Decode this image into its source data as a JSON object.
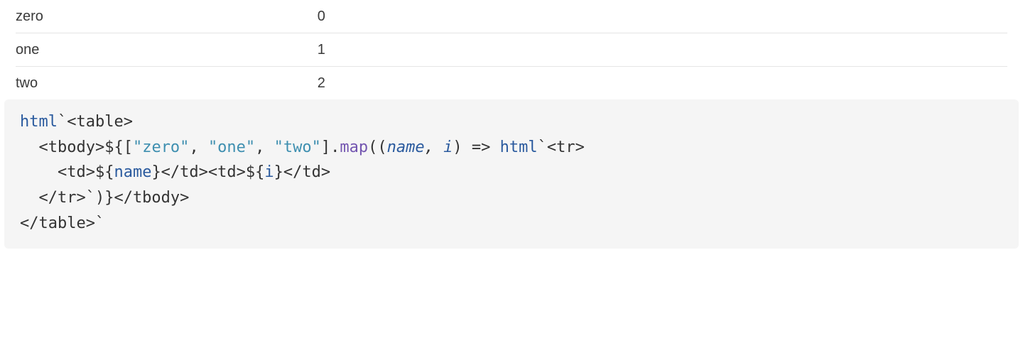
{
  "table": {
    "rows": [
      {
        "name": "zero",
        "index": "0"
      },
      {
        "name": "one",
        "index": "1"
      },
      {
        "name": "two",
        "index": "2"
      }
    ]
  },
  "code": {
    "tokens": [
      {
        "t": "html",
        "c": "tok-fn"
      },
      {
        "t": "`<table>\n  <tbody>${[",
        "c": ""
      },
      {
        "t": "\"zero\"",
        "c": "tok-str"
      },
      {
        "t": ", ",
        "c": ""
      },
      {
        "t": "\"one\"",
        "c": "tok-str"
      },
      {
        "t": ", ",
        "c": ""
      },
      {
        "t": "\"two\"",
        "c": "tok-str"
      },
      {
        "t": "].",
        "c": ""
      },
      {
        "t": "map",
        "c": "tok-method"
      },
      {
        "t": "((",
        "c": ""
      },
      {
        "t": "name",
        "c": "tok-id tok-italic"
      },
      {
        "t": ", ",
        "c": "tok-italic"
      },
      {
        "t": "i",
        "c": "tok-id tok-italic"
      },
      {
        "t": ") => ",
        "c": ""
      },
      {
        "t": "html",
        "c": "tok-fn"
      },
      {
        "t": "`<tr>\n    <td>${",
        "c": ""
      },
      {
        "t": "name",
        "c": "tok-id"
      },
      {
        "t": "}</td><td>${",
        "c": ""
      },
      {
        "t": "i",
        "c": "tok-id"
      },
      {
        "t": "}</td>\n  </tr>`)}</tbody>\n</table>`",
        "c": ""
      }
    ]
  }
}
